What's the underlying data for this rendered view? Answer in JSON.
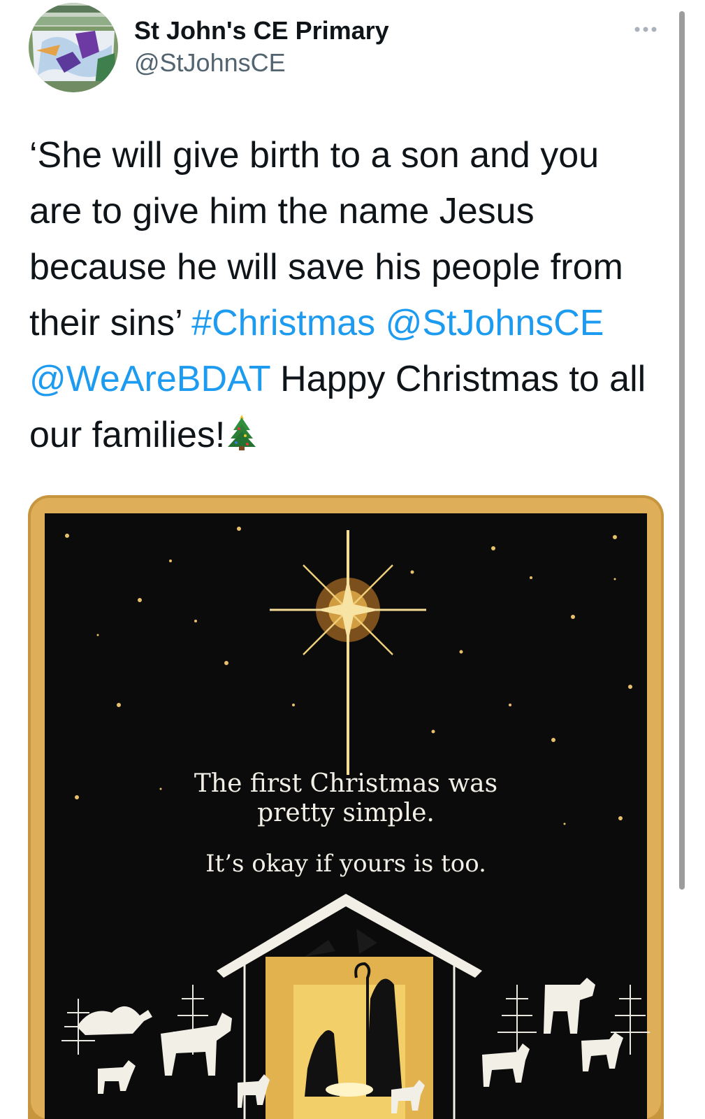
{
  "tweet": {
    "author_name": "St John's CE Primary",
    "author_handle": "@StJohnsCE",
    "avatar_icon": "school-badge-icon",
    "more_icon": "more-options-icon",
    "text": {
      "quote": "‘She will give birth to a son and you are to give him the name Jesus because he will save his people from their sins’",
      "hashtag": "#Christmas",
      "mention1": "@StJohnsCE",
      "mention2": "@WeAreBDAT",
      "message": "Happy Christmas to all our families!",
      "emoji_icon": "christmas-tree-icon"
    },
    "media": {
      "image_lines": [
        "The first Christmas was",
        "pretty simple.",
        "It’s okay if yours is too."
      ],
      "frame_color": "#d9a44a",
      "background_color": "#0b0b0b"
    },
    "colors": {
      "link": "#1d9bf0",
      "text": "#0f1419",
      "secondary": "#536471"
    }
  }
}
